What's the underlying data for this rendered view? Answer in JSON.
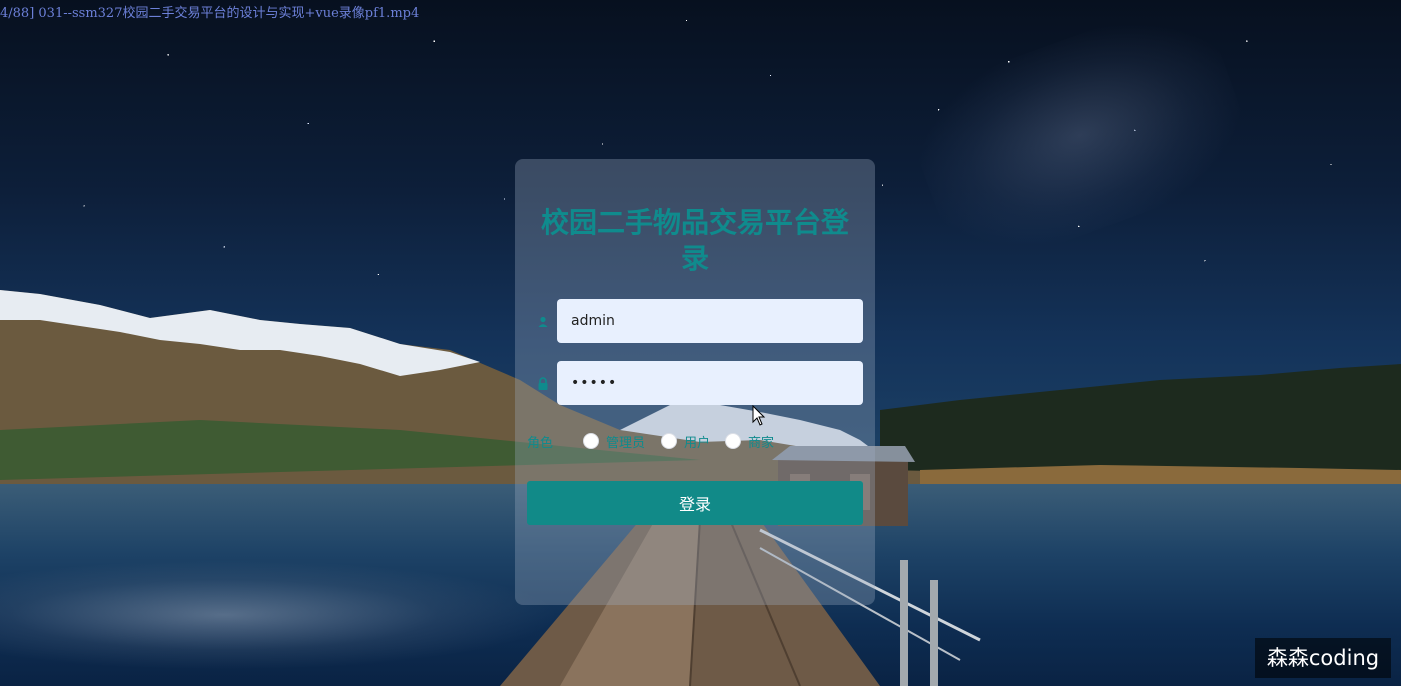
{
  "video": {
    "title": "4/88] 031--ssm327校园二手交易平台的设计与实现+vue录像pf1.mp4"
  },
  "watermark": {
    "text": "森森coding"
  },
  "login": {
    "title": "校园二手物品交易平台登录",
    "username_value": "admin",
    "password_value": "•••••",
    "role_label": "角色",
    "roles": [
      "管理员",
      "用户",
      "商家"
    ],
    "submit_label": "登录"
  },
  "colors": {
    "accent": "#0f8b8d",
    "button": "#118a88",
    "input_bg": "#e8f0fe"
  },
  "icons": {
    "username": "user-icon",
    "password": "lock-icon"
  }
}
